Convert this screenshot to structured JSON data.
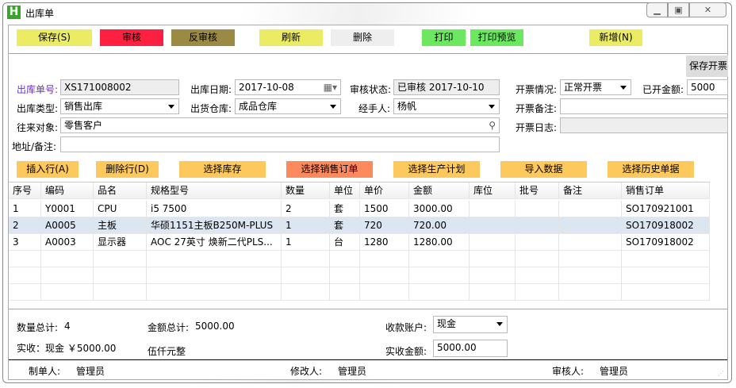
{
  "window": {
    "title": "出库单",
    "logo": "H",
    "controls": [
      "minimize-icon",
      "restore-icon",
      "close-icon"
    ]
  },
  "toolbar": [
    {
      "label": "保存(S)",
      "color": "#ecec64"
    },
    {
      "label": "审核",
      "color": "#fe2040"
    },
    {
      "label": "反审核",
      "color": "#9a8a44"
    },
    {
      "label": "刷新",
      "color": "#ecec64"
    },
    {
      "label": "删除",
      "color": "#eeeeee"
    },
    {
      "label": "打印",
      "color": "#6ce860"
    },
    {
      "label": "打印预览",
      "color": "#6ce860"
    },
    {
      "label": "新增(N)",
      "color": "#ecec64"
    }
  ],
  "save_invoice_label": "保存开票",
  "form": {
    "order_no_label": "出库单号:",
    "order_no": "XS171008002",
    "date_label": "出库日期:",
    "date": "2017-10-08",
    "audit_label": "审核状态:",
    "audit": "已审核 2017-10-10",
    "invoice_status_label": "开票情况:",
    "invoice_status": "正常开票",
    "invoiced_amount_label": "已开金额:",
    "invoiced_amount": "5000",
    "type_label": "出库类型:",
    "type": "销售出库",
    "warehouse_label": "出货仓库:",
    "warehouse": "成品仓库",
    "handler_label": "经手人:",
    "handler": "杨帆",
    "invoice_note_label": "开票备注:",
    "invoice_note": "",
    "partner_label": "往来对象:",
    "partner": "零售客户",
    "invoice_log_label": "开票日志:",
    "invoice_log": "",
    "address_label": "地址/备注:",
    "address": ""
  },
  "actions": [
    {
      "label": "插入行(A)",
      "color": "#fdc85c"
    },
    {
      "label": "删除行(D)",
      "color": "#fdc85c"
    },
    {
      "label": "选择库存",
      "color": "#fdc85c"
    },
    {
      "label": "选择销售订单",
      "color": "#fd8a5c"
    },
    {
      "label": "选择生产计划",
      "color": "#fdc85c"
    },
    {
      "label": "导入数据",
      "color": "#fdc85c"
    },
    {
      "label": "选择历史单据",
      "color": "#fdc85c"
    }
  ],
  "table": {
    "columns": [
      "序号",
      "编码",
      "品名",
      "规格型号",
      "数量",
      "单位",
      "单价",
      "金额",
      "库位",
      "批号",
      "备注",
      "销售订单"
    ],
    "rows": [
      [
        "1",
        "Y0001",
        "CPU",
        "i5 7500",
        "2",
        "套",
        "1500",
        "3000.00",
        "",
        "",
        "",
        "SO170921001"
      ],
      [
        "2",
        "A0005",
        "主板",
        "华硕1151主板B250M-PLUS",
        "1",
        "套",
        "720",
        "720.00",
        "",
        "",
        "",
        "SO170918002"
      ],
      [
        "3",
        "A0003",
        "显示器",
        "AOC 27英寸 焕新二代PLS...",
        "1",
        "台",
        "1280",
        "1280.00",
        "",
        "",
        "",
        "SO170918002"
      ]
    ],
    "selected_row": 1
  },
  "summary": {
    "qty_label": "数量总计:",
    "qty": "4",
    "amount_label": "金额总计:",
    "amount": "5000.00",
    "account_label": "收款账户:",
    "account": "现金",
    "received_text": "实收：现金 ￥5000.00",
    "amount_words": "伍仟元整",
    "received_label": "实收金额:",
    "received": "5000.00"
  },
  "footer": {
    "creator_label": "制单人:",
    "creator": "管理员",
    "modifier_label": "修改人:",
    "modifier": "管理员",
    "auditor_label": "审核人:",
    "auditor": "管理员"
  }
}
